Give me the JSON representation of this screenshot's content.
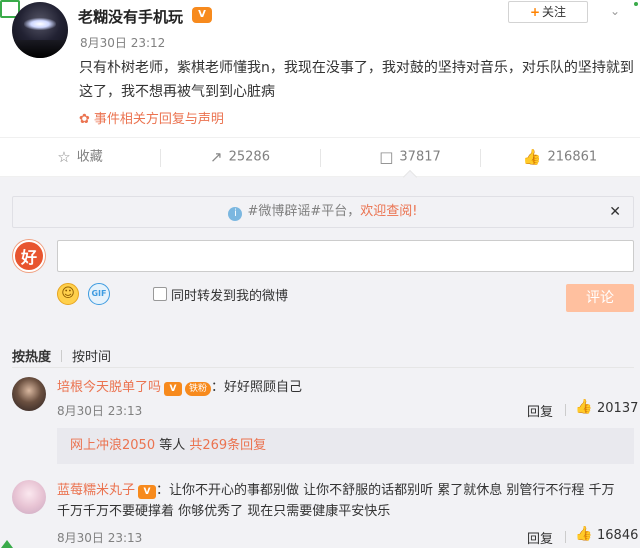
{
  "post": {
    "author": "老糊没有手机玩",
    "vip_badge": "V",
    "follow_label": "关注",
    "time": "8月30日 23:12",
    "text": "只有朴树老师，紫棋老师懂我n，我现在没事了，我对鼓的坚持对音乐，对乐队的坚持就到这了，我不想再被气到到心脏病",
    "event_link": "事件相关方回复与声明"
  },
  "actions": {
    "favorite_label": "收藏",
    "repost_count": "25286",
    "comment_count": "37817",
    "like_count": "216861"
  },
  "notice": {
    "prefix": "#微博辟谣#平台，",
    "highlight": "欢迎查阅!"
  },
  "composer": {
    "repost_label": "同时转发到我的微博",
    "submit_label": "评论"
  },
  "sort": {
    "hot": "按热度",
    "time": "按时间"
  },
  "comments": [
    {
      "user": "培根今天脱单了吗",
      "fan_badge": "铁粉",
      "text": "：好好照顾自己",
      "time": "8月30日 23:13",
      "reply_label": "回复",
      "likes": "20137",
      "sub_user": "网上冲浪2050",
      "sub_text": " 等人",
      "sub_link": " 共269条回复"
    },
    {
      "user": "蓝莓糯米丸子",
      "text_line1": "：让你不开心的事都别做 让你不舒服的话都别听 累了就休息 别管行不行程 千万",
      "text_line2": "千万千万不要硬撑着 你够优秀了 现在只需要健康平安快乐",
      "time": "8月30日 23:13",
      "reply_label": "回复",
      "likes": "16846"
    }
  ],
  "colors": {
    "accent": "#eb7350",
    "submit_bg": "#ffc09f",
    "bg_gray": "#f2f2f5"
  }
}
